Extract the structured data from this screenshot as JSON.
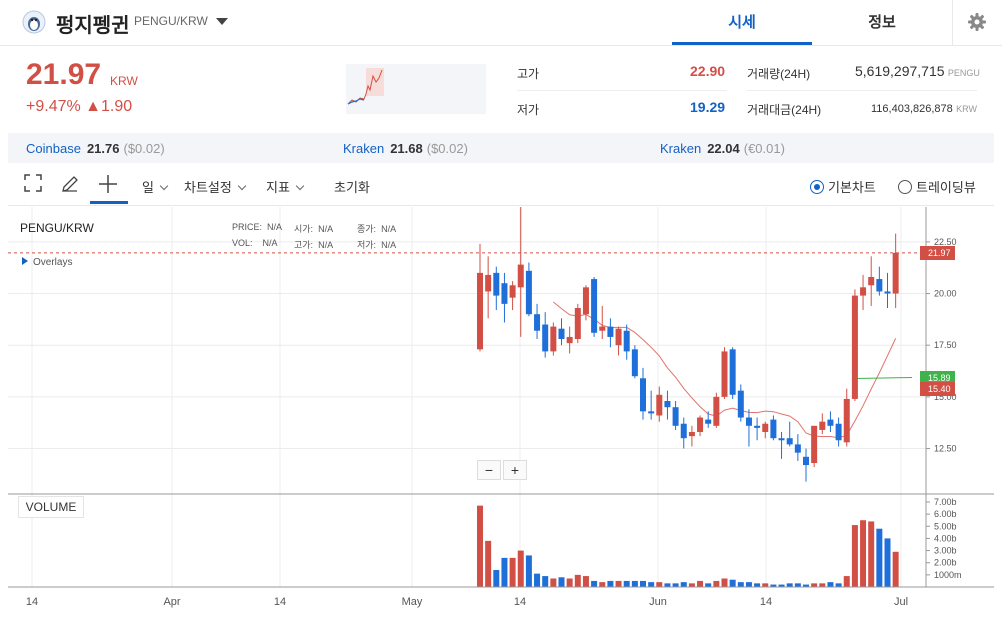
{
  "header": {
    "coin_name": "펑지펭귄",
    "pair": "PENGU/KRW",
    "tabs": [
      "시세",
      "정보"
    ]
  },
  "summary": {
    "price": "21.97",
    "unit": "KRW",
    "change_pct": "+9.47%",
    "change_abs": "▲1.90",
    "high_label": "고가",
    "high": "22.90",
    "low_label": "저가",
    "low": "19.29",
    "volume_label": "거래량(24H)",
    "volume": "5,619,297,715",
    "volume_unit": "PENGU",
    "amount_label": "거래대금(24H)",
    "amount": "116,403,826,878",
    "amount_unit": "KRW"
  },
  "exchanges": [
    {
      "name": "Coinbase",
      "price": "21.76",
      "diff": "($0.02)"
    },
    {
      "name": "Kraken",
      "price": "21.68",
      "diff": "($0.02)"
    },
    {
      "name": "Kraken",
      "price": "22.04",
      "diff": "(€0.01)"
    }
  ],
  "toolbar": {
    "period": "일",
    "chart_settings": "차트설정",
    "indicator": "지표",
    "reset": "초기화",
    "basic_chart": "기본차트",
    "tradingview": "트레이딩뷰"
  },
  "legend": {
    "title": "PENGU/KRW",
    "price_label": "PRICE:",
    "open_label": "시가:",
    "close_label": "종가:",
    "vol_label": "VOL:",
    "high_label": "고가:",
    "low_label": "저가:",
    "na": "N/A",
    "overlays": "Overlays"
  },
  "volume_label": "VOLUME",
  "zoom": {
    "minus": "−",
    "plus": "+"
  },
  "colors": {
    "up": "#d24f45",
    "down": "#1e6fd9",
    "accent": "#1261c4",
    "ma_red": "#e0736a",
    "ma_green": "#3fb24a"
  },
  "chart_data": {
    "type": "candlestick",
    "x_tick_labels": [
      "14",
      "Apr",
      "14",
      "May",
      "14",
      "Jun",
      "14",
      "Jul"
    ],
    "y_ticks": [
      "22.50",
      "20.00",
      "17.50",
      "15.00",
      "12.50"
    ],
    "ylim": [
      10.3,
      23.8
    ],
    "volume_ticks": [
      "7.00b",
      "6.00b",
      "5.00b",
      "4.00b",
      "3.00b",
      "2.00b",
      "1000m"
    ],
    "volume_ylim": [
      0,
      7.0
    ],
    "current_price_tag": "21.97",
    "ma_tags": [
      "15.89",
      "15.40"
    ],
    "candles": [
      {
        "o": 17.3,
        "h": 22.4,
        "l": 17.2,
        "c": 21.0
      },
      {
        "o": 20.1,
        "h": 21.8,
        "l": 18.8,
        "c": 20.9
      },
      {
        "o": 21.0,
        "h": 21.3,
        "l": 19.2,
        "c": 19.9
      },
      {
        "o": 20.5,
        "h": 21.0,
        "l": 18.6,
        "c": 19.5
      },
      {
        "o": 19.8,
        "h": 20.6,
        "l": 19.2,
        "c": 20.4
      },
      {
        "o": 20.3,
        "h": 24.6,
        "l": 17.9,
        "c": 21.4
      },
      {
        "o": 21.1,
        "h": 21.5,
        "l": 18.9,
        "c": 19.0
      },
      {
        "o": 19.0,
        "h": 19.5,
        "l": 17.8,
        "c": 18.2
      },
      {
        "o": 18.5,
        "h": 19.1,
        "l": 16.9,
        "c": 17.2
      },
      {
        "o": 17.2,
        "h": 18.6,
        "l": 17.0,
        "c": 18.4
      },
      {
        "o": 18.3,
        "h": 18.8,
        "l": 17.5,
        "c": 17.8
      },
      {
        "o": 17.6,
        "h": 18.4,
        "l": 17.1,
        "c": 17.9
      },
      {
        "o": 17.8,
        "h": 19.5,
        "l": 17.6,
        "c": 19.3
      },
      {
        "o": 19.0,
        "h": 20.4,
        "l": 18.7,
        "c": 20.3
      },
      {
        "o": 20.7,
        "h": 20.8,
        "l": 17.9,
        "c": 18.1
      },
      {
        "o": 18.2,
        "h": 19.4,
        "l": 17.8,
        "c": 18.4
      },
      {
        "o": 18.4,
        "h": 18.8,
        "l": 17.4,
        "c": 17.9
      },
      {
        "o": 17.5,
        "h": 18.4,
        "l": 17.0,
        "c": 18.3
      },
      {
        "o": 18.2,
        "h": 18.5,
        "l": 16.8,
        "c": 17.2
      },
      {
        "o": 17.3,
        "h": 17.5,
        "l": 15.9,
        "c": 16.0
      },
      {
        "o": 15.9,
        "h": 16.4,
        "l": 13.9,
        "c": 14.3
      },
      {
        "o": 14.3,
        "h": 15.3,
        "l": 13.9,
        "c": 14.2
      },
      {
        "o": 14.1,
        "h": 15.5,
        "l": 13.8,
        "c": 15.1
      },
      {
        "o": 14.8,
        "h": 15.3,
        "l": 13.9,
        "c": 14.5
      },
      {
        "o": 14.5,
        "h": 14.8,
        "l": 13.4,
        "c": 13.6
      },
      {
        "o": 13.7,
        "h": 14.0,
        "l": 12.5,
        "c": 13.0
      },
      {
        "o": 13.1,
        "h": 13.6,
        "l": 12.6,
        "c": 13.3
      },
      {
        "o": 13.3,
        "h": 14.1,
        "l": 13.1,
        "c": 14.0
      },
      {
        "o": 13.9,
        "h": 14.3,
        "l": 13.5,
        "c": 13.7
      },
      {
        "o": 13.6,
        "h": 15.2,
        "l": 13.5,
        "c": 15.0
      },
      {
        "o": 15.0,
        "h": 17.4,
        "l": 14.9,
        "c": 17.2
      },
      {
        "o": 17.3,
        "h": 17.4,
        "l": 14.9,
        "c": 15.1
      },
      {
        "o": 15.3,
        "h": 15.6,
        "l": 13.8,
        "c": 14.0
      },
      {
        "o": 14.0,
        "h": 14.4,
        "l": 12.6,
        "c": 13.6
      },
      {
        "o": 13.6,
        "h": 14.0,
        "l": 12.9,
        "c": 13.5
      },
      {
        "o": 13.3,
        "h": 13.8,
        "l": 13.0,
        "c": 13.7
      },
      {
        "o": 13.9,
        "h": 14.1,
        "l": 12.9,
        "c": 13.0
      },
      {
        "o": 13.0,
        "h": 13.3,
        "l": 12.0,
        "c": 12.9
      },
      {
        "o": 13.0,
        "h": 13.8,
        "l": 12.6,
        "c": 12.7
      },
      {
        "o": 12.7,
        "h": 13.2,
        "l": 11.9,
        "c": 12.3
      },
      {
        "o": 12.1,
        "h": 12.5,
        "l": 10.9,
        "c": 11.7
      },
      {
        "o": 11.8,
        "h": 13.5,
        "l": 11.6,
        "c": 13.6
      },
      {
        "o": 13.4,
        "h": 14.2,
        "l": 13.2,
        "c": 13.8
      },
      {
        "o": 13.9,
        "h": 14.3,
        "l": 13.3,
        "c": 13.6
      },
      {
        "o": 13.7,
        "h": 14.0,
        "l": 12.6,
        "c": 12.9
      },
      {
        "o": 12.8,
        "h": 15.4,
        "l": 12.6,
        "c": 14.9
      },
      {
        "o": 14.9,
        "h": 20.2,
        "l": 14.8,
        "c": 19.9
      },
      {
        "o": 19.9,
        "h": 20.9,
        "l": 19.2,
        "c": 20.3
      },
      {
        "o": 20.4,
        "h": 21.8,
        "l": 19.4,
        "c": 20.8
      },
      {
        "o": 20.7,
        "h": 21.3,
        "l": 19.9,
        "c": 20.1
      },
      {
        "o": 20.1,
        "h": 21.0,
        "l": 19.3,
        "c": 20.0
      },
      {
        "o": 20.0,
        "h": 22.9,
        "l": 19.3,
        "c": 21.97
      }
    ],
    "volumes": [
      6.7,
      3.8,
      1.4,
      2.4,
      2.4,
      3.0,
      2.6,
      1.1,
      0.9,
      0.7,
      0.8,
      0.7,
      1.0,
      0.9,
      0.5,
      0.4,
      0.5,
      0.5,
      0.5,
      0.5,
      0.5,
      0.4,
      0.4,
      0.3,
      0.3,
      0.4,
      0.3,
      0.5,
      0.3,
      0.5,
      0.7,
      0.6,
      0.4,
      0.4,
      0.3,
      0.3,
      0.2,
      0.2,
      0.3,
      0.3,
      0.2,
      0.3,
      0.3,
      0.4,
      0.3,
      0.9,
      5.1,
      5.5,
      5.4,
      4.8,
      4.0,
      2.9
    ]
  }
}
